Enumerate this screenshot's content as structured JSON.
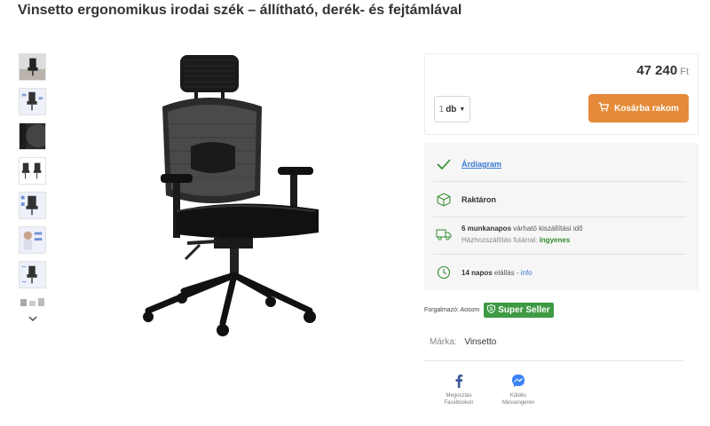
{
  "product": {
    "title": "Vinsetto ergonomikus irodai szék – állítható, derék- és fejtámlával"
  },
  "gallery": {
    "thumb_count": 8,
    "down_icon": "chevron-down-icon"
  },
  "purchase": {
    "price": "47 240",
    "currency": "Ft",
    "qty_number": "1",
    "qty_unit": "db",
    "cart_label": "Kosárba rakom",
    "cart_icon": "cart-icon",
    "accent_color": "#e58a38"
  },
  "info": {
    "price_chart_label": "Árdiagram",
    "stock_label": "Raktáron",
    "delivery_days": "6 munkanapos",
    "delivery_text": "várható kiszállítási idő",
    "shipping_text": "Házhozszállítás futárral:",
    "shipping_value": "ingyenes",
    "return_days": "14 napos",
    "return_text": "elállás -",
    "return_link": "info"
  },
  "seller": {
    "label": "Forgalmazó: Aosom",
    "badge": "Super Seller",
    "badge_color": "#3e9a45"
  },
  "brand": {
    "label": "Márka:",
    "value": "Vinsetto"
  },
  "share": {
    "facebook_line1": "Megosztás",
    "facebook_line2": "Facebookon",
    "messenger_line1": "Küldés",
    "messenger_line2": "Messengeren"
  }
}
